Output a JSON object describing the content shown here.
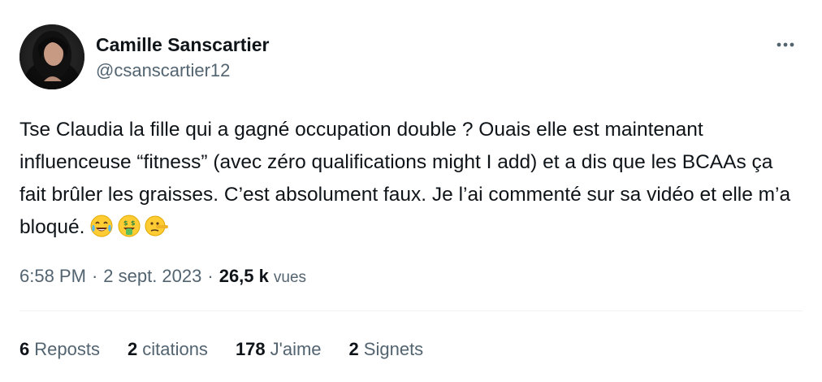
{
  "author": {
    "display_name": "Camille Sanscartier",
    "handle": "@csanscartier12"
  },
  "tweet": {
    "text": "Tse Claudia la fille qui a gagné occupation double ? Ouais elle est maintenant influenceuse “fitness” (avec zéro qualifications might I add) et a dis que les BCAAs ça fait brûler les graisses. C’est absolument faux. Je l’ai commenté sur sa vidéo et elle m’a bloqué.",
    "emojis": [
      "face-with-tears-of-joy-icon",
      "money-mouth-face-icon",
      "lying-face-icon"
    ]
  },
  "meta": {
    "time": "6:58 PM",
    "separator": "·",
    "date": "2 sept. 2023",
    "views_count": "26,5 k",
    "views_label": "vues"
  },
  "stats": {
    "reposts": {
      "count": "6",
      "label": "Reposts"
    },
    "quotes": {
      "count": "2",
      "label": "citations"
    },
    "likes": {
      "count": "178",
      "label": "J'aime"
    },
    "bookmarks": {
      "count": "2",
      "label": "Signets"
    }
  },
  "icons": {
    "more": "more-horizontal-icon"
  },
  "colors": {
    "primary_text": "#0f1419",
    "secondary_text": "#536471",
    "divider": "#eff3f4"
  }
}
